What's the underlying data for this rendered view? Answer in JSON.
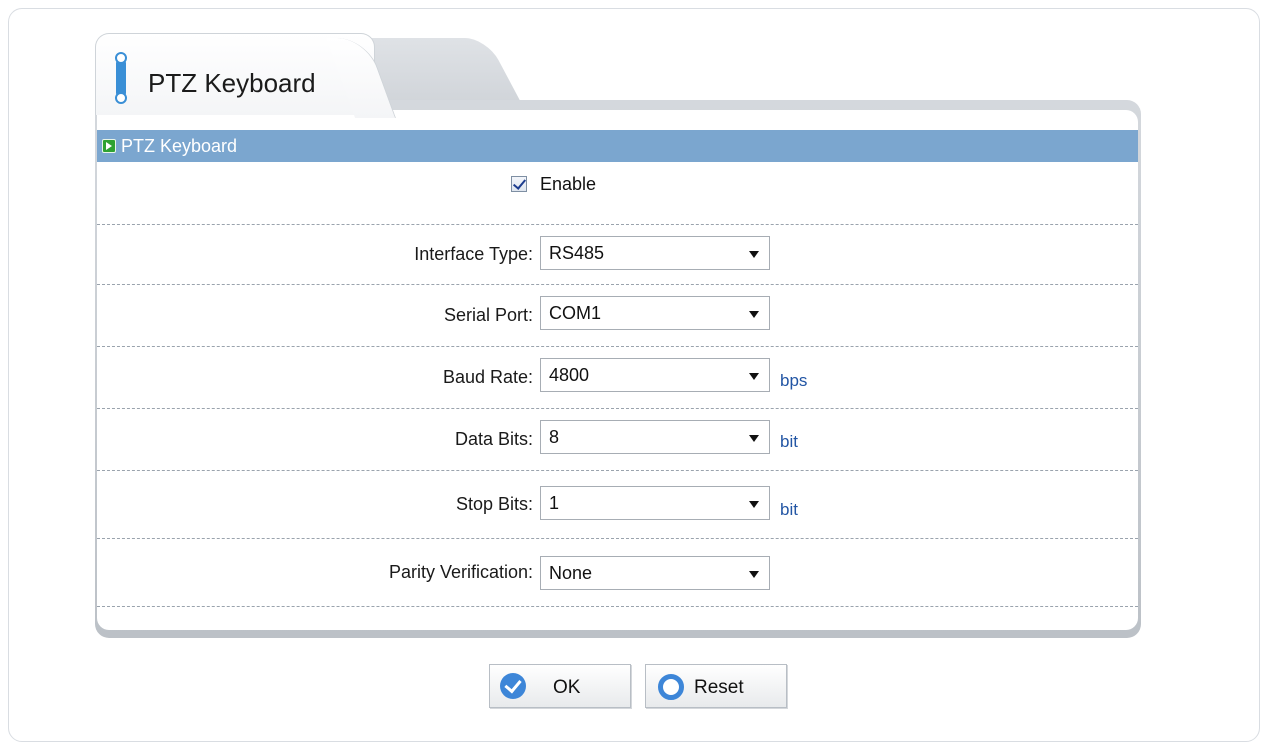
{
  "tab": {
    "title": "PTZ Keyboard"
  },
  "section": {
    "header": "PTZ Keyboard"
  },
  "form": {
    "enable_label": "Enable",
    "enable_checked": true,
    "fields": [
      {
        "label": "Interface Type:",
        "value": "RS485",
        "unit": ""
      },
      {
        "label": "Serial Port:",
        "value": "COM1",
        "unit": ""
      },
      {
        "label": "Baud Rate:",
        "value": "4800",
        "unit": "bps"
      },
      {
        "label": "Data Bits:",
        "value": "8",
        "unit": "bit"
      },
      {
        "label": "Stop Bits:",
        "value": "1",
        "unit": "bit"
      },
      {
        "label": "Parity Verification:",
        "value": "None",
        "unit": ""
      }
    ]
  },
  "buttons": {
    "ok_label": "OK",
    "reset_label": "Reset"
  },
  "colors": {
    "section_header_bg": "#7ba6cf",
    "accent_blue": "#3d86d8",
    "unit_text": "#2255a4"
  },
  "icons": {
    "tab": "tab-marker-icon",
    "section": "green-arrow-icon",
    "ok": "checkmark-circle-icon",
    "reset": "ring-circle-icon",
    "dropdown": "chevron-down-icon"
  }
}
